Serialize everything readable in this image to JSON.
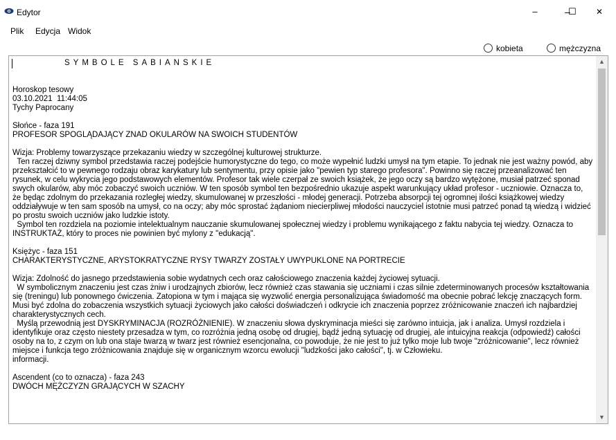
{
  "window": {
    "title": "Edytor",
    "controls": {
      "minimize": "–",
      "maximize": "☐",
      "close": "✕"
    }
  },
  "menu": {
    "items": [
      "Plik",
      "Edycja",
      "Widok"
    ]
  },
  "gender": {
    "option_female": "kobieta",
    "option_male": "mężczyzna"
  },
  "document": {
    "heading": "SYMBOLE SABIAŃSKIE",
    "meta": [
      "Horoskop tesowy",
      "03.10.2021  11:44:05",
      "Tychy Paprocany"
    ],
    "sections": [
      {
        "label": "Słońce - faza 191",
        "title": "PROFESOR SPOGLĄDAJĄCY ZNAD OKULARÓW NA SWOICH STUDENTÓW",
        "body": "Wizja: Problemy towarzyszące przekazaniu wiedzy w szczególnej kulturowej strukturze.\n  Ten raczej dziwny symbol przedstawia raczej podejście humorystyczne do tego, co może wypełnić ludzki umysł na tym etapie. To jednak nie jest ważny powód, aby przekształcić to w pewnego rodzaju obraz karykatury lub sentymentu, przy opisie jako \"pewien typ starego profesora\". Powinno się raczej przeanalizować ten rysunek, w celu wykrycia jego podstawowych elementów. Profesor tak wiele czerpał ze swoich książek, że jego oczy są bardzo wytężone, musiał patrzeć sponad swych okularów, aby móc zobaczyć swoich uczniów. W ten sposób symbol ten bezpośrednio ukazuje aspekt warunkujący układ profesor - uczniowie. Oznacza to, że będąc zdolnym do przekazania rozległej wiedzy, skumulowanej w przeszłości - młodej generacji. Potrzeba absorpcji tej ogromnej ilości książkowej wiedzy oddziaływuje w ten sam sposób na umysł, co na oczy; aby móc sprostać żądaniom niecierpliwej młodości nauczyciel istotnie musi patrzeć ponad tą wiedzą i widzieć po prostu swoich uczniów jako ludzkie istoty.\n  Symbol ten rozdziela na poziomie intelektualnym nauczanie skumulowanej społecznej wiedzy i problemu wynikającego z faktu nabycia tej wiedzy. Oznacza to INSTRUKTAŻ, który to proces nie powinien być mylony z \"edukacją\"."
      },
      {
        "label": "Księżyc - faza 151",
        "title": "CHARAKTERYSTYCZNE, ARYSTOKRATYCZNE RYSY TWARZY ZOSTAŁY UWYPUKLONE NA PORTRECIE",
        "body": "Wizja: Zdolność do jasnego przedstawienia sobie wydatnych cech oraz całościowego znaczenia każdej życiowej sytuacji.\n  W symbolicznym znaczeniu jest czas żniw i urodzajnych zbiorów, lecz również czas stawania się uczniami i czas silnie zdeterminowanych procesów kształtowania się (treningu) lub ponownego ćwiczenia. Zatopiona w tym i mająca się wyzwolić energia personalizująca świadomość ma obecnie pobrać lekcję znaczących form. Musi być zdolna do zobaczenia wszystkich sytuacji życiowych jako całości doświadczeń i odkrycie ich znaczenia poprzez zróżnicowanie znaczeń ich najbardziej charakterystycznych cech.\n  Myślą przewodnią jest DYSKRYMINACJA (ROZRÓŻNIENIE). W znaczeniu słowa dyskryminacja mieści się zarówno intuicja, jak i analiza. Umysł rozdziela i identyfikuje oraz często niestety przesadza w tym, co rozróżnia jedną osobę od drugiej, bądź jedną sytuację od drugiej, ale intuicyjna reakcja (odpowiedź) całości osoby na to, z czym on lub ona staje twarzą w twarz jest również esencjonalna, co powoduje, że nie jest to już tylko moje lub twoje \"zróżnicowanie\", lecz również miejsce i funkcja tego zróżnicowania znajduje się w organicznym wzorcu ewolucji \"ludzkości jako całości\", tj. w Człowieku.\ninformacji."
      },
      {
        "label": "Ascendent (co to oznacza) - faza 243",
        "title": "DWÓCH MĘŻCZYZN GRAJĄCYCH W SZACHY",
        "body": ""
      }
    ]
  },
  "colors": {
    "window_bg": "#ffffff",
    "scroll_track": "#f0f0f0",
    "scroll_thumb": "#c0c0c0",
    "border": "#a0a0a0"
  },
  "icons": {
    "app": "eye-icon",
    "scroll_up": "chevron-up-icon",
    "scroll_down": "chevron-down-icon"
  }
}
